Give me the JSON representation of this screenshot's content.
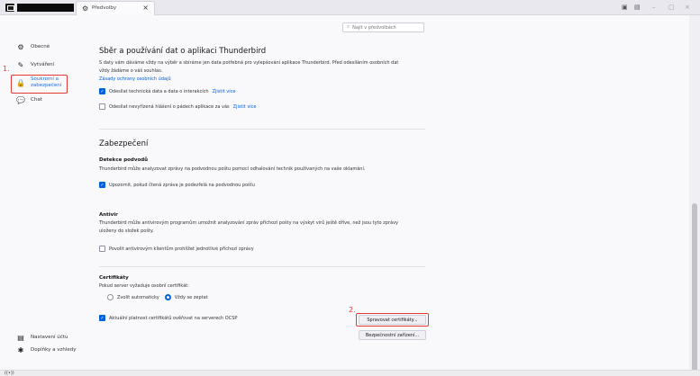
{
  "tab": {
    "title": "Předvolby",
    "close": "×"
  },
  "topbar": {
    "layout_icon": "▣",
    "pane_icon": "▤",
    "minimize": "–",
    "maximize": "▢",
    "close": "×"
  },
  "search": {
    "placeholder": "Najít v předvolbách",
    "icon": "⌕"
  },
  "sidebar": {
    "items": [
      {
        "label": "Obecné",
        "icon": "⚙"
      },
      {
        "label": "Vytváření",
        "icon": "✎"
      },
      {
        "label_line1": "Soukromí a",
        "label_line2": "zabezpečení",
        "icon": "🔒"
      },
      {
        "label": "Chat",
        "icon": "💬"
      }
    ],
    "bottom": [
      {
        "label": "Nastavení účtu",
        "icon": "▤"
      },
      {
        "label": "Doplňky a vzhledy",
        "icon": "✱"
      }
    ]
  },
  "annotations": {
    "one": "1.",
    "two": "2."
  },
  "data_collection": {
    "title": "Sběr a používání dat o aplikaci Thunderbird",
    "desc_line1": "S daty vám dáváme vždy na výběr a sbíráme jen data potřebná pro vylepšování aplikace Thunderbird. Před odesíláním osobních dat",
    "desc_line2": "vždy žádáme o váš souhlas.",
    "privacy_link": "Zásady ochrany osobních údajů",
    "telemetry_label": "Odesílat technická data a data o interakcích",
    "learn_more": "Zjistit více",
    "crash_label": "Odesílat nevyřízená hlášení o pádech aplikace za vás"
  },
  "security": {
    "title": "Zabezpečení",
    "scam": {
      "heading": "Detekce podvodů",
      "desc": "Thunderbird může analyzovat zprávy na podvodnou poštu pomocí odhalování technik používaných na vaše oklamání.",
      "checkbox": "Upozornit, pokud čtená zpráva je podezřelá na podvodnou poštu"
    },
    "antivirus": {
      "heading": "Antivir",
      "desc_line1": "Thunderbird může antivirovým programům umožnit analyzování zpráv příchozí pošty na výskyt virů ještě dříve, než jsou tyto zprávy",
      "desc_line2": "uloženy do složek pošty.",
      "checkbox": "Povolit antivirovým klientům prohlížet jednotlivé příchozí zprávy"
    },
    "certificates": {
      "heading": "Certifikáty",
      "desc": "Pokud server vyžaduje osobní certifikát:",
      "radio_auto": "Zvolit automaticky",
      "radio_ask": "Vždy se zeptat",
      "ocsp_label": "Aktuální platnost certifikátů ověřovat na serverech OCSP",
      "manage_button": "Spravovat certifikáty...",
      "devices_button": "Bezpečnostní zařízení..."
    }
  },
  "statusbar": {
    "icon": "((•))"
  }
}
